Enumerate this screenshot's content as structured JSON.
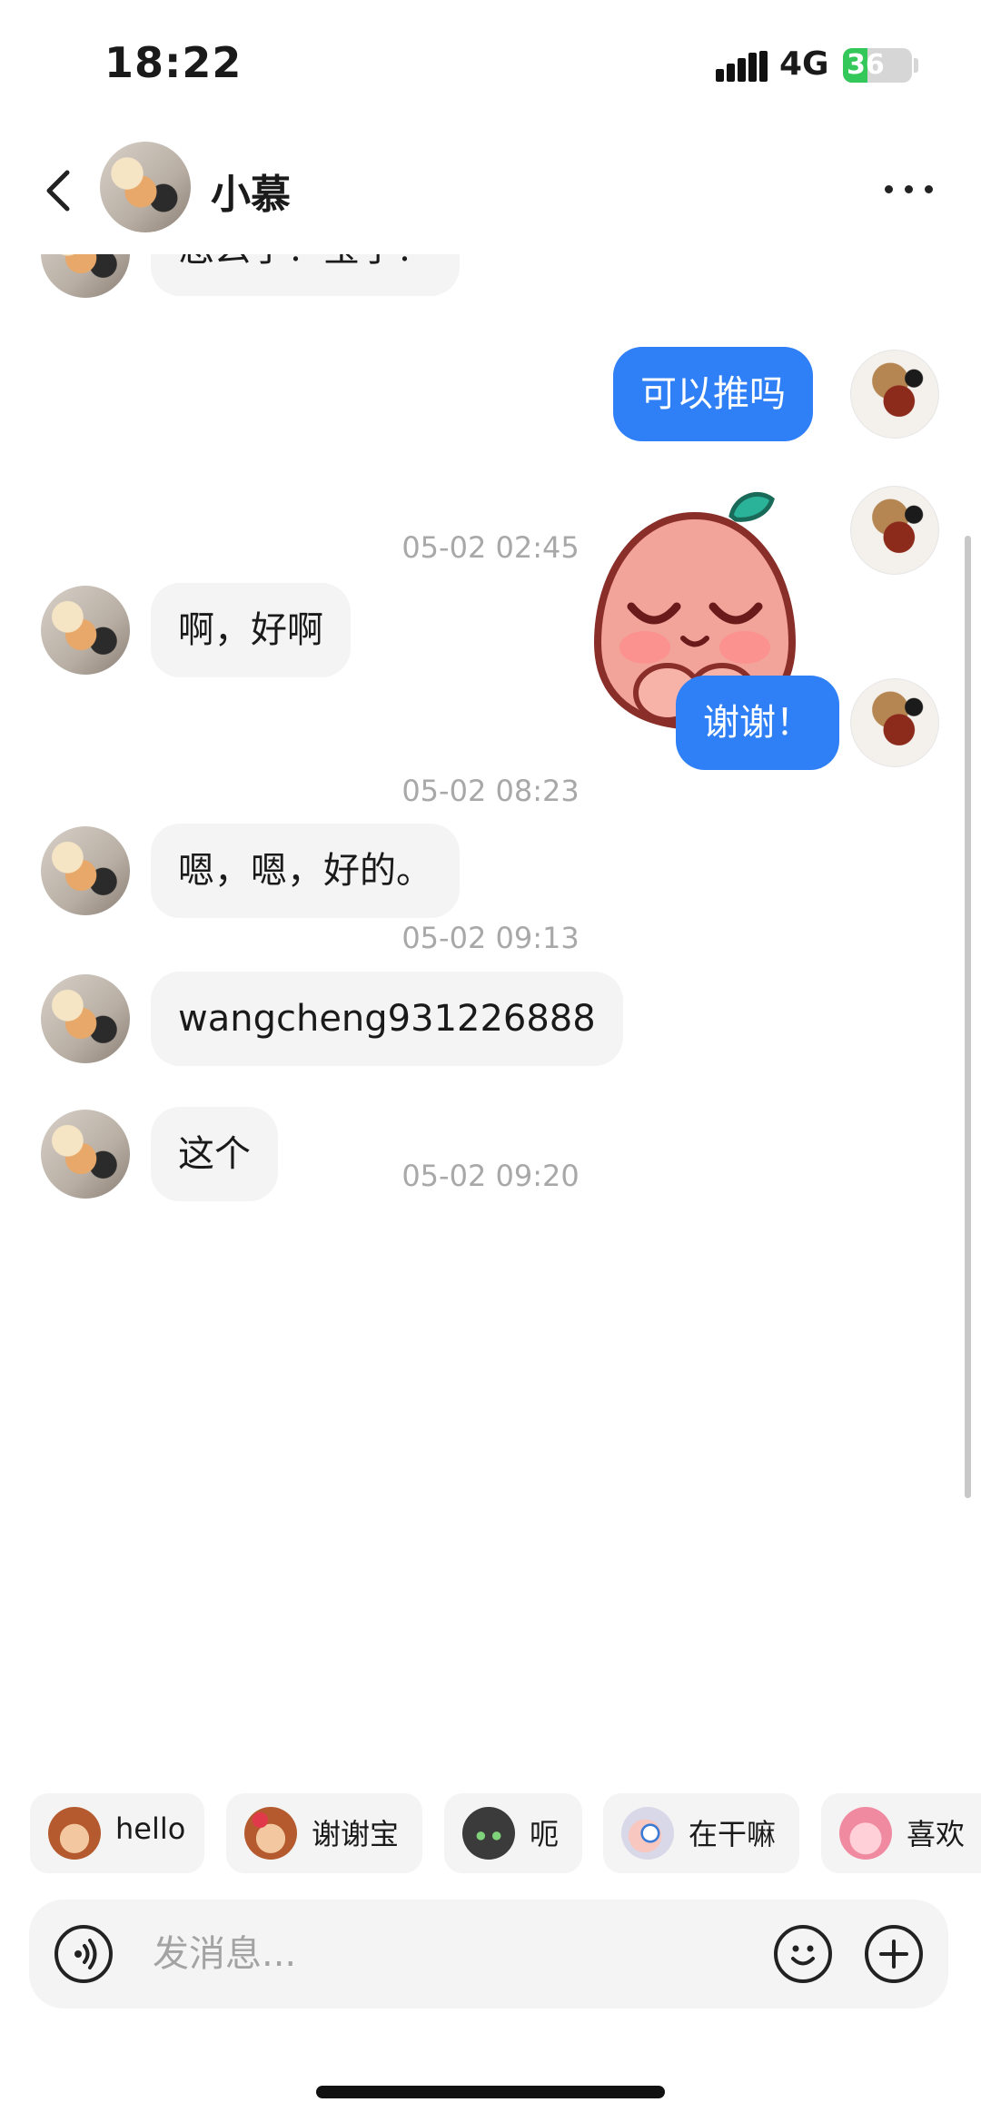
{
  "status_bar": {
    "time": "18:22",
    "network": "4G",
    "battery": "36",
    "battery_level_percent": 36
  },
  "header": {
    "contact_name": "小慕"
  },
  "messages": {
    "m0": "怎么了？宝子？",
    "m1": "可以推吗",
    "ts1": "05-02 02:45",
    "m2": "啊，好啊",
    "m3": "谢谢！",
    "ts2": "05-02 08:23",
    "m4": "嗯，嗯，好的。",
    "ts3": "05-02 09:13",
    "m5": "wangcheng931226888",
    "m6": "这个",
    "ts4": "05-02 09:20"
  },
  "quick_replies": [
    "hello",
    "谢谢宝",
    "呃",
    "在干嘛",
    "喜欢"
  ],
  "composer": {
    "placeholder": "发消息..."
  },
  "colors": {
    "outgoing_bubble": "#2f7ff6",
    "incoming_bubble": "#f4f4f4",
    "battery_green": "#34c759"
  },
  "icons": {
    "back": "chevron-left-icon",
    "more": "ellipsis-icon",
    "voice": "voice-wave-icon",
    "emoji": "smiley-icon",
    "plus": "plus-circle-icon"
  }
}
